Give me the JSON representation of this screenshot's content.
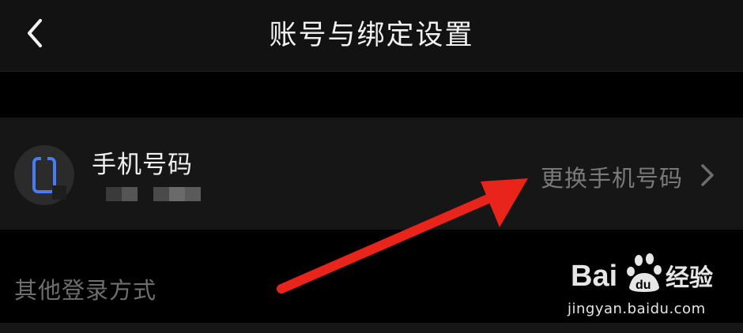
{
  "nav": {
    "title": "账号与绑定设置"
  },
  "phone_binding": {
    "title": "手机号码",
    "action": "更换手机号码",
    "icon": "phone-icon"
  },
  "other_login": {
    "label": "其他登录方式"
  },
  "watermark": {
    "brand_text": "Bai经验",
    "url": "jingyan.baidu.com"
  },
  "colors": {
    "phone_icon": "#4a7cf0",
    "annotation_arrow": "#e8241b"
  }
}
